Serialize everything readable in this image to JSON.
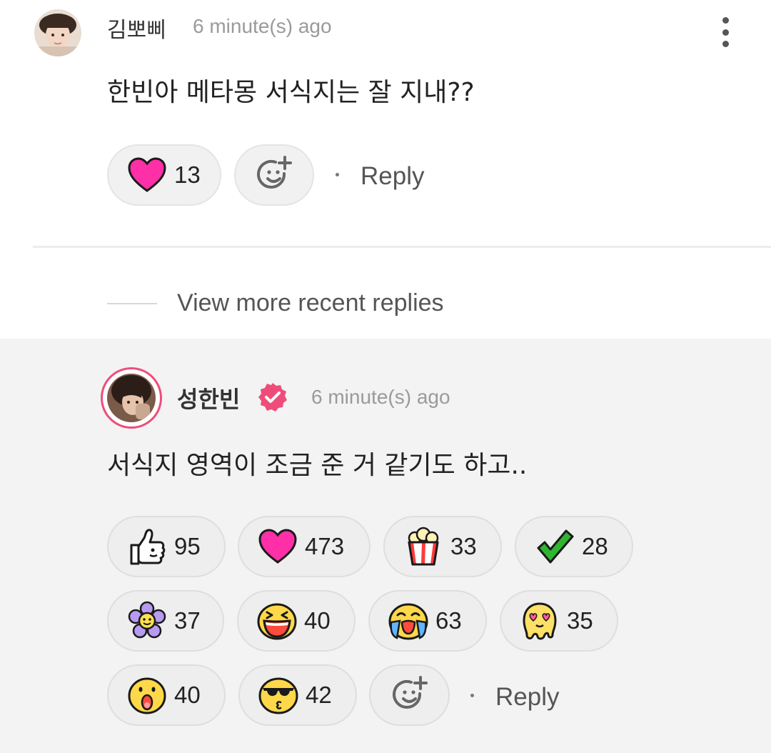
{
  "comment": {
    "author": "김뽀삐",
    "time": "6 minute(s) ago",
    "text": "한빈아 메타몽 서식지는 잘 지내??",
    "reactions": [
      {
        "icon": "heart-emoji-icon",
        "count": "13"
      }
    ],
    "reply_label": "Reply"
  },
  "view_more": "View more recent replies",
  "reply": {
    "author": "성한빈",
    "verified": true,
    "time": "6 minute(s) ago",
    "text": "서식지 영역이 조금 준 거 같기도 하고..",
    "reactions": [
      {
        "icon": "thumbs-up-emoji-icon",
        "count": "95"
      },
      {
        "icon": "heart-emoji-icon",
        "count": "473"
      },
      {
        "icon": "popcorn-emoji-icon",
        "count": "33"
      },
      {
        "icon": "check-emoji-icon",
        "count": "28"
      },
      {
        "icon": "flower-emoji-icon",
        "count": "37"
      },
      {
        "icon": "laughing-emoji-icon",
        "count": "40"
      },
      {
        "icon": "crying-emoji-icon",
        "count": "63"
      },
      {
        "icon": "heart-eyes-emoji-icon",
        "count": "35"
      },
      {
        "icon": "surprised-emoji-icon",
        "count": "40"
      },
      {
        "icon": "sunglasses-emoji-icon",
        "count": "42"
      }
    ],
    "reply_label": "Reply"
  },
  "colors": {
    "heart": "#ff2fa8",
    "accent": "#ee4d7a",
    "check": "#2fb52f"
  }
}
